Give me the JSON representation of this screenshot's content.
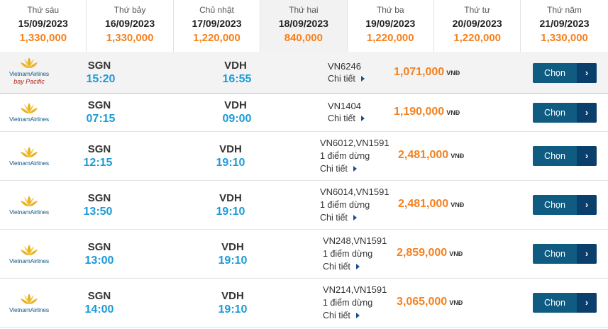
{
  "dates": [
    {
      "dow": "Thứ sáu",
      "date": "15/09/2023",
      "price": "1,330,000",
      "active": false
    },
    {
      "dow": "Thứ bảy",
      "date": "16/09/2023",
      "price": "1,330,000",
      "active": false
    },
    {
      "dow": "Chủ nhật",
      "date": "17/09/2023",
      "price": "1,220,000",
      "active": false
    },
    {
      "dow": "Thứ hai",
      "date": "18/09/2023",
      "price": "840,000",
      "active": true
    },
    {
      "dow": "Thứ ba",
      "date": "19/09/2023",
      "price": "1,220,000",
      "active": false
    },
    {
      "dow": "Thứ tư",
      "date": "20/09/2023",
      "price": "1,220,000",
      "active": false
    },
    {
      "dow": "Thứ năm",
      "date": "21/09/2023",
      "price": "1,330,000",
      "active": false
    }
  ],
  "common": {
    "airline_name": "VietnamAirlines",
    "airline_sub": "bay Pacific",
    "detail_label": "Chi tiết",
    "select_label": "Chọn",
    "currency": "VNĐ"
  },
  "colors": {
    "price": "#f4811f",
    "time": "#1b9bd8",
    "button": "#0f5b82",
    "logo_lotus": "#e8b222"
  },
  "flights": [
    {
      "from": "SGN",
      "dep": "15:20",
      "to": "VDH",
      "arr": "16:55",
      "flight_no": "VN6246",
      "stops": "",
      "price": "1,071,000",
      "pacific": true
    },
    {
      "from": "SGN",
      "dep": "07:15",
      "to": "VDH",
      "arr": "09:00",
      "flight_no": "VN1404",
      "stops": "",
      "price": "1,190,000",
      "pacific": false
    },
    {
      "from": "SGN",
      "dep": "12:15",
      "to": "VDH",
      "arr": "19:10",
      "flight_no": "VN6012,VN1591",
      "stops": "1 điểm dừng",
      "price": "2,481,000",
      "pacific": false
    },
    {
      "from": "SGN",
      "dep": "13:50",
      "to": "VDH",
      "arr": "19:10",
      "flight_no": "VN6014,VN1591",
      "stops": "1 điểm dừng",
      "price": "2,481,000",
      "pacific": false
    },
    {
      "from": "SGN",
      "dep": "13:00",
      "to": "VDH",
      "arr": "19:10",
      "flight_no": "VN248,VN1591",
      "stops": "1 điểm dừng",
      "price": "2,859,000",
      "pacific": false
    },
    {
      "from": "SGN",
      "dep": "14:00",
      "to": "VDH",
      "arr": "19:10",
      "flight_no": "VN214,VN1591",
      "stops": "1 điểm dừng",
      "price": "3,065,000",
      "pacific": false
    }
  ]
}
